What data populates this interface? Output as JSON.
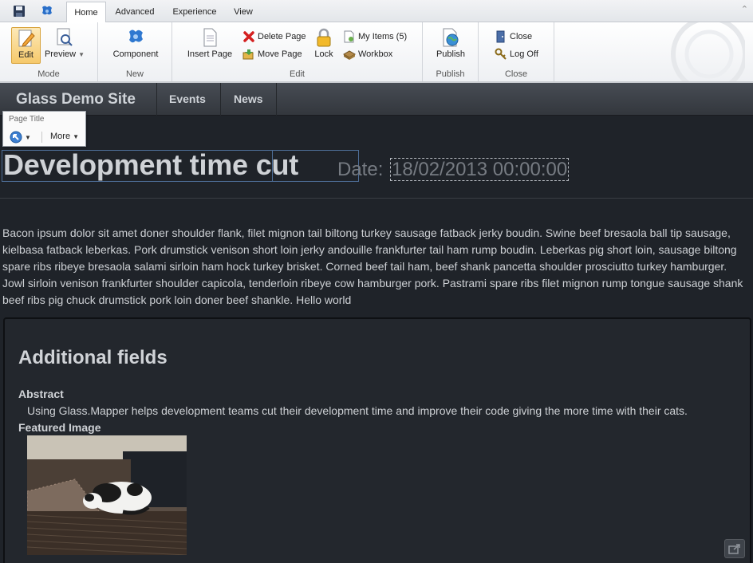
{
  "ribbon": {
    "tabs": [
      {
        "label": "Home",
        "active": true
      },
      {
        "label": "Advanced",
        "active": false
      },
      {
        "label": "Experience",
        "active": false
      },
      {
        "label": "View",
        "active": false
      }
    ],
    "groups": {
      "mode": {
        "label": "Mode",
        "edit": "Edit",
        "preview": "Preview"
      },
      "new": {
        "label": "New",
        "component": "Component"
      },
      "edit": {
        "label": "Edit",
        "insert_page": "Insert Page",
        "delete_page": "Delete Page",
        "move_page": "Move Page",
        "lock": "Lock",
        "my_items": "My Items (5)",
        "workbox": "Workbox"
      },
      "publish": {
        "label": "Publish",
        "publish": "Publish"
      },
      "close": {
        "label": "Close",
        "close": "Close",
        "log_off": "Log Off"
      }
    }
  },
  "site": {
    "brand": "Glass Demo Site",
    "nav": [
      "Events",
      "News"
    ]
  },
  "field_chrome": {
    "title": "Page Title",
    "more": "More"
  },
  "page": {
    "title_part1": "Development time",
    "title_part2": " cut",
    "date_label": "Date:",
    "date_value": "18/02/2013 00:00:00",
    "body": "Bacon ipsum dolor sit amet doner shoulder flank, filet mignon tail biltong turkey sausage fatback jerky boudin. Swine beef bresaola ball tip sausage, kielbasa fatback leberkas. Pork drumstick venison short loin jerky andouille frankfurter tail ham rump boudin. Leberkas pig short loin, sausage biltong spare ribs ribeye bresaola salami sirloin ham hock turkey brisket. Corned beef tail ham, beef shank pancetta shoulder prosciutto turkey hamburger. Jowl sirloin venison frankfurter shoulder capicola, tenderloin ribeye cow hamburger pork. Pastrami spare ribs filet mignon rump tongue sausage shank beef ribs pig chuck drumstick pork loin doner beef shankle. Hello world"
  },
  "additional": {
    "heading": "Additional fields",
    "abstract_label": "Abstract",
    "abstract_text": "Using Glass.Mapper helps development teams cut their development time and improve their code giving the more time with their cats.",
    "image_label": "Featured Image"
  },
  "colors": {
    "page_bg": "#1f2329",
    "nav_bg": "#3c4047",
    "text": "#cdd0d4",
    "field_border": "#4e6e97"
  }
}
